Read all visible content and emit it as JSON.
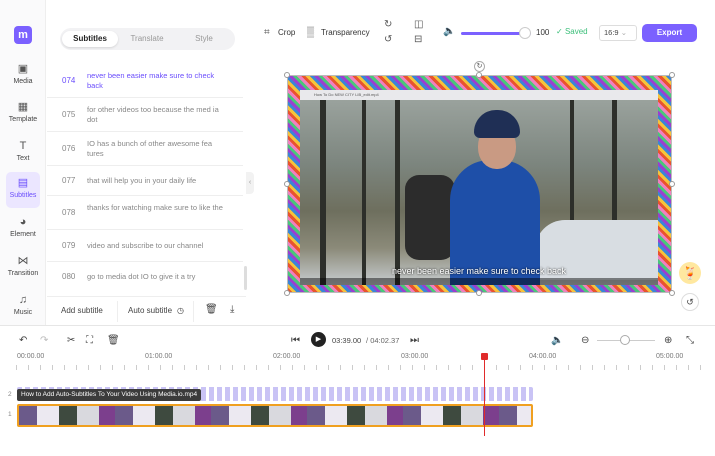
{
  "app": {
    "logo": "m",
    "accent": "#7b61ff",
    "saved_color": "#3cbf7a"
  },
  "nav": [
    {
      "label": "Media",
      "icon": "media-icon"
    },
    {
      "label": "Template",
      "icon": "template-icon"
    },
    {
      "label": "Text",
      "icon": "text-icon"
    },
    {
      "label": "Subtitles",
      "icon": "subtitles-icon",
      "active": true
    },
    {
      "label": "Element",
      "icon": "element-icon"
    },
    {
      "label": "Transition",
      "icon": "transition-icon"
    },
    {
      "label": "Music",
      "icon": "music-icon"
    }
  ],
  "subtitle_panel": {
    "tabs": [
      "Subtitles",
      "Translate",
      "Style"
    ],
    "active_tab": "Subtitles",
    "rows": [
      {
        "num": "074",
        "text": "never been easier make sure to check back",
        "active": true
      },
      {
        "num": "075",
        "text": "for other videos too because the med ia dot"
      },
      {
        "num": "076",
        "text": "IO has a bunch of other awesome fea tures"
      },
      {
        "num": "077",
        "text": "that will help you in your daily life"
      },
      {
        "num": "078",
        "text": "thanks for watching make sure to like the"
      },
      {
        "num": "079",
        "text": "video and subscribe to our channel"
      },
      {
        "num": "080",
        "text": "go to media dot IO to give it a try"
      }
    ],
    "actions": {
      "add": "Add subtitle",
      "auto": "Auto subtitle"
    }
  },
  "toolbar": {
    "crop": "Crop",
    "transparency": "Transparency",
    "volume": "100",
    "volume_level_percent": 100,
    "saved": "Saved",
    "ratio": "16:9",
    "export": "Export"
  },
  "canvas": {
    "browser_tab": "How To Do NEW CITY LIB_edit.mp4",
    "caption": "never been easier make sure to check back"
  },
  "timeline": {
    "current": "03:39.00",
    "separator": "/",
    "total": "04:02.37",
    "ruler": [
      "00:00.00",
      "01:00.00",
      "02:00.00",
      "03:00.00",
      "04:00.00",
      "05:00.00"
    ],
    "track2_num": "2",
    "track1_num": "1",
    "clip_label": "How to Add Auto-Subtitles To Your Video Using Media.io.mp4"
  }
}
